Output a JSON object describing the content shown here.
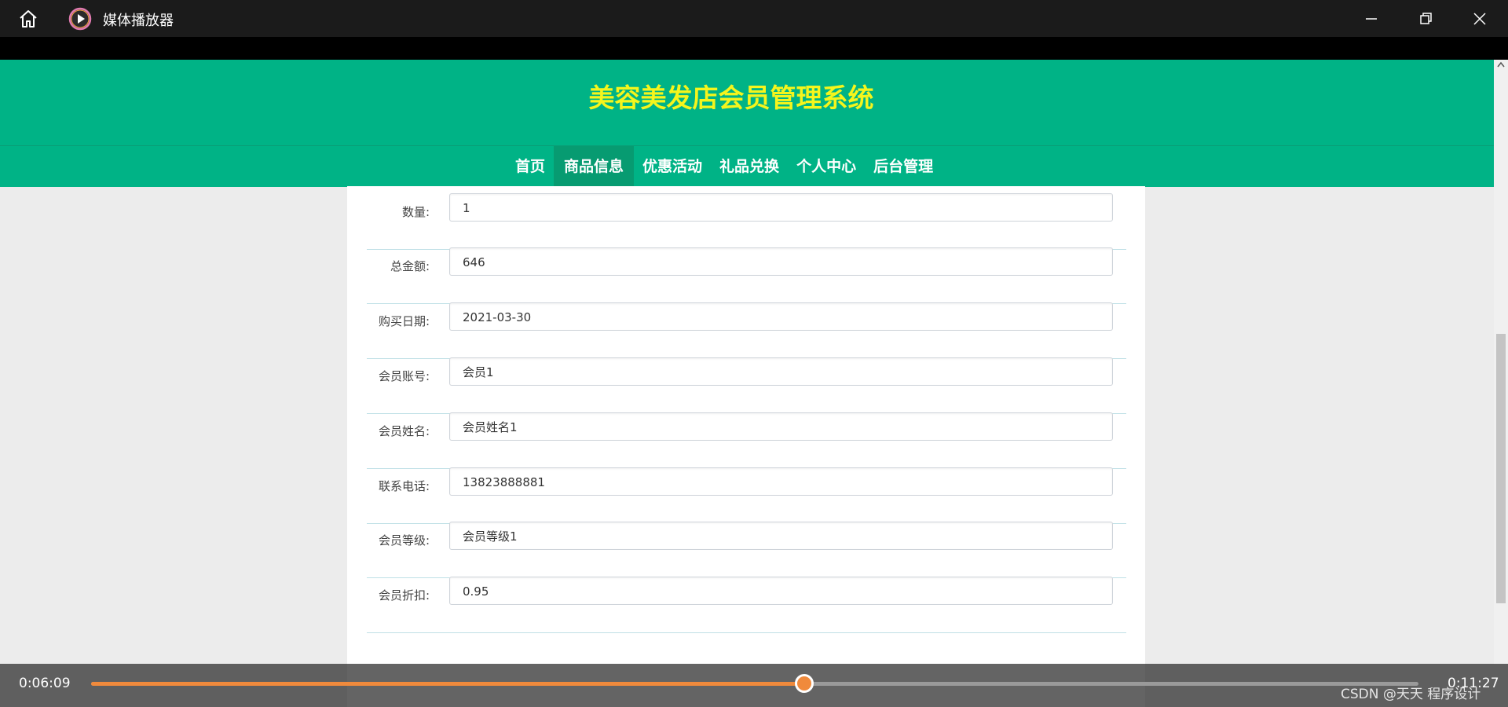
{
  "window": {
    "title": "媒体播放器",
    "icons": {
      "home": "home-icon",
      "app": "play-circle-icon",
      "minimize": "minimize-icon",
      "maximize": "restore-icon",
      "close": "close-icon"
    }
  },
  "site": {
    "title": "美容美发店会员管理系统",
    "title_color": "#f5f51c",
    "brand_color": "#00b386",
    "nav": [
      {
        "label": "首页",
        "active": false
      },
      {
        "label": "商品信息",
        "active": true
      },
      {
        "label": "优惠活动",
        "active": false
      },
      {
        "label": "礼品兑换",
        "active": false
      },
      {
        "label": "个人中心",
        "active": false
      },
      {
        "label": "后台管理",
        "active": false
      }
    ]
  },
  "form": {
    "fields": [
      {
        "label": "数量:",
        "value": "1"
      },
      {
        "label": "总金额:",
        "value": "646"
      },
      {
        "label": "购买日期:",
        "value": "2021-03-30"
      },
      {
        "label": "会员账号:",
        "value": "会员1"
      },
      {
        "label": "会员姓名:",
        "value": "会员姓名1"
      },
      {
        "label": "联系电话:",
        "value": "13823888881"
      },
      {
        "label": "会员等级:",
        "value": "会员等级1"
      },
      {
        "label": "会员折扣:",
        "value": "0.95"
      }
    ]
  },
  "player": {
    "current_time": "0:06:09",
    "total_time": "0:11:27",
    "progress": 0.537,
    "accent_color": "#f08a3c"
  },
  "watermark": "CSDN @天天 程序设计"
}
